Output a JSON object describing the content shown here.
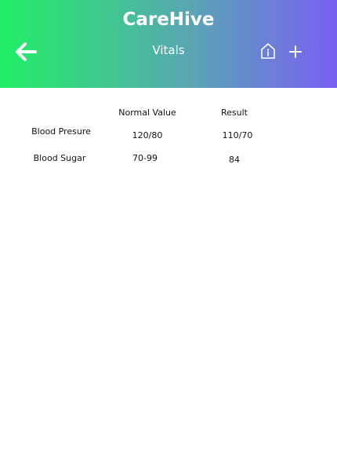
{
  "header": {
    "app_title": "CareHive",
    "page_title": "Vitals",
    "gradient_start": "#22ee66",
    "gradient_end": "#7a5ff2",
    "icons": [
      "arrow-left-icon",
      "home-info-icon",
      "plus-icon"
    ]
  },
  "table": {
    "columns": [
      "",
      "Normal Value",
      "Result"
    ],
    "rows": [
      {
        "name": "Blood Presure",
        "normal": "120/80",
        "result": "110/70"
      },
      {
        "name": "Blood Sugar",
        "normal": "70-99",
        "result": "84"
      }
    ]
  }
}
